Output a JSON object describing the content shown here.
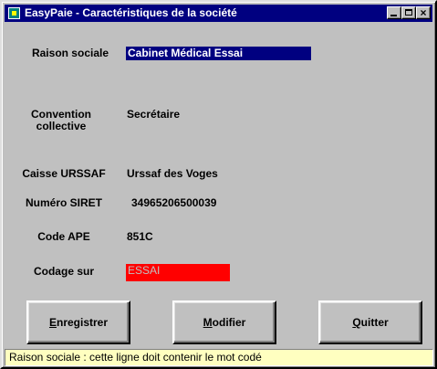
{
  "window": {
    "title": "EasyPaie - Caractéristiques de la société"
  },
  "titlebar_buttons": {
    "minimize": "minimize",
    "maximize": "maximize",
    "close": "×"
  },
  "fields": {
    "raison_sociale": {
      "label": "Raison sociale",
      "value": "Cabinet Médical Essai"
    },
    "convention_collective": {
      "label_line1": "Convention",
      "label_line2": "collective",
      "value": "Secrétaire"
    },
    "caisse_urssaf": {
      "label": "Caisse URSSAF",
      "value": "Urssaf des Voges"
    },
    "numero_siret": {
      "label": "Numéro SIRET",
      "value": "34965206500039"
    },
    "code_ape": {
      "label": "Code APE",
      "value": "851C"
    },
    "codage_sur": {
      "label": "Codage sur",
      "value": "ESSAI"
    }
  },
  "buttons": {
    "save": "Enregistrer",
    "modify": "Modifier",
    "quit": "Quitter"
  },
  "status": {
    "text": "Raison sociale : cette ligne doit contenir le mot codé"
  },
  "colors": {
    "titlebar": "#000080",
    "selected_field": "#000080",
    "codage_field": "#ff0000",
    "status_bg": "#ffffc0",
    "window_bg": "#c0c0c0"
  }
}
